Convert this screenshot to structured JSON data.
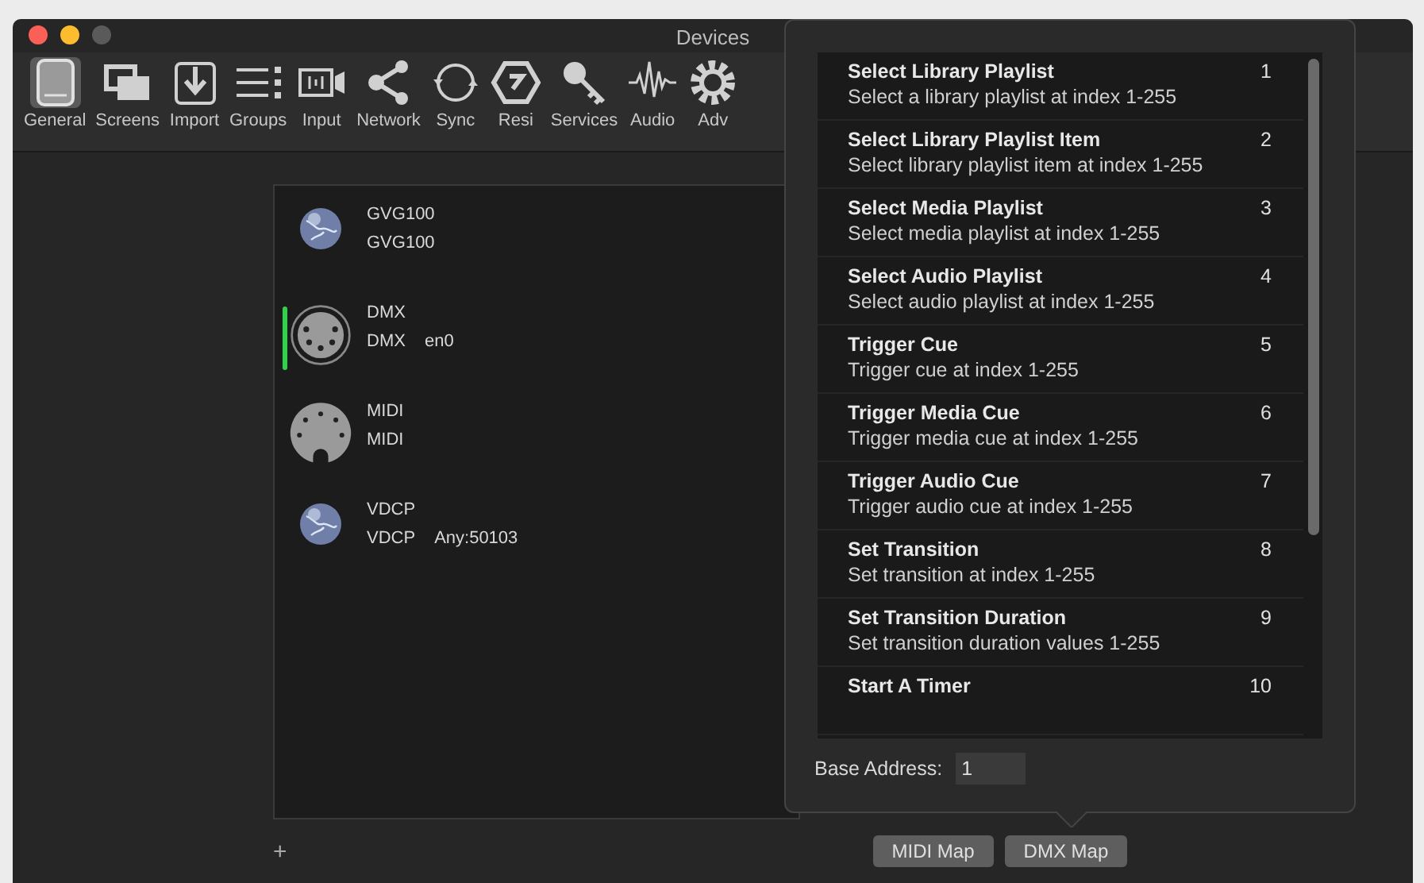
{
  "window": {
    "title": "Devices"
  },
  "toolbar": [
    {
      "label": "General",
      "kind": "tablet",
      "selected": true
    },
    {
      "label": "Screens",
      "kind": "screens",
      "selected": false
    },
    {
      "label": "Import",
      "kind": "import",
      "selected": false
    },
    {
      "label": "Groups",
      "kind": "groups",
      "selected": false
    },
    {
      "label": "Input",
      "kind": "input",
      "selected": false
    },
    {
      "label": "Network",
      "kind": "network",
      "selected": false
    },
    {
      "label": "Sync",
      "kind": "sync",
      "selected": false
    },
    {
      "label": "Resi",
      "kind": "resi",
      "selected": false
    },
    {
      "label": "Services",
      "kind": "key",
      "selected": false
    },
    {
      "label": "Audio",
      "kind": "wave",
      "selected": false
    },
    {
      "label": "Adv",
      "kind": "gear",
      "selected": false
    }
  ],
  "devices": [
    {
      "name": "GVG100",
      "type": "GVG100",
      "kind": "globe",
      "selected": false
    },
    {
      "name": "DMX",
      "type": "DMX",
      "detail": "en0",
      "kind": "dmx",
      "selected": true
    },
    {
      "name": "MIDI",
      "type": "MIDI",
      "kind": "midi",
      "selected": false
    },
    {
      "name": "VDCP",
      "type": "VDCP",
      "detail": "Any:50103",
      "kind": "globe",
      "selected": false
    }
  ],
  "add_button": "+",
  "popover": {
    "commands": [
      {
        "title": "Select Library Playlist",
        "description": "Select a library playlist at index 1-255",
        "channel": "1"
      },
      {
        "title": "Select Library Playlist Item",
        "description": "Select library playlist item at index 1-255",
        "channel": "2"
      },
      {
        "title": "Select Media Playlist",
        "description": "Select media playlist at index 1-255",
        "channel": "3"
      },
      {
        "title": "Select Audio Playlist",
        "description": "Select audio playlist at index 1-255",
        "channel": "4"
      },
      {
        "title": "Trigger Cue",
        "description": "Trigger cue at index 1-255",
        "channel": "5"
      },
      {
        "title": "Trigger Media Cue",
        "description": "Trigger media cue at index 1-255",
        "channel": "6"
      },
      {
        "title": "Trigger Audio Cue",
        "description": "Trigger audio cue at index 1-255",
        "channel": "7"
      },
      {
        "title": "Set Transition",
        "description": "Set transition at index 1-255",
        "channel": "8"
      },
      {
        "title": "Set Transition Duration",
        "description": "Set transition duration values 1-255",
        "channel": "9"
      },
      {
        "title": "Start A Timer",
        "channel": "10"
      }
    ],
    "base_address_label": "Base Address:",
    "base_address": "1"
  },
  "buttons": [
    "MIDI Map",
    "DMX Map"
  ]
}
